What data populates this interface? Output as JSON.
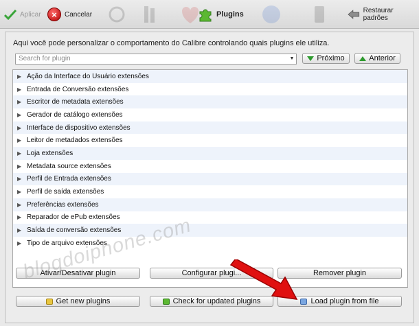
{
  "toolbar": {
    "apply_label": "Aplicar",
    "cancel_label": "Cancelar",
    "plugins_label": "Plugins",
    "restore_label": "Restaurar padrões"
  },
  "intro_text": "Aqui você pode personalizar o comportamento do Calibre controlando quais plugins ele utiliza.",
  "search": {
    "placeholder": "Search for plugin"
  },
  "nav": {
    "next_label": "Próximo",
    "prev_label": "Anterior"
  },
  "plugin_categories": [
    "Ação da Interface do Usuário extensões",
    "Entrada de Conversão extensões",
    "Escritor de metadata extensões",
    "Gerador de catálogo extensões",
    "Interface de dispositivo extensões",
    "Leitor de metadados extensões",
    "Loja extensões",
    "Metadata source extensões",
    "Perfil de Entrada extensões",
    "Perfil de saída extensões",
    "Preferências extensões",
    "Reparador de ePub extensões",
    "Saída de conversão extensões",
    "Tipo de arquivo extensões"
  ],
  "actions": {
    "toggle_label": "Ativar/Desativar plugin",
    "configure_label": "Configurar plugi...",
    "remove_label": "Remover plugin",
    "get_new_label": "Get new plugins",
    "check_updates_label": "Check for updated plugins",
    "load_file_label": "Load plugin from file"
  },
  "watermark_text": "blogdoiphone.com",
  "colors": {
    "accent_green": "#2d9a2d",
    "annotation_red": "#e01010"
  },
  "icons": [
    "check-icon",
    "cancel-icon",
    "puzzle-icon",
    "restore-icon",
    "expand-arrow-icon",
    "down-arrow-icon",
    "up-arrow-icon"
  ]
}
